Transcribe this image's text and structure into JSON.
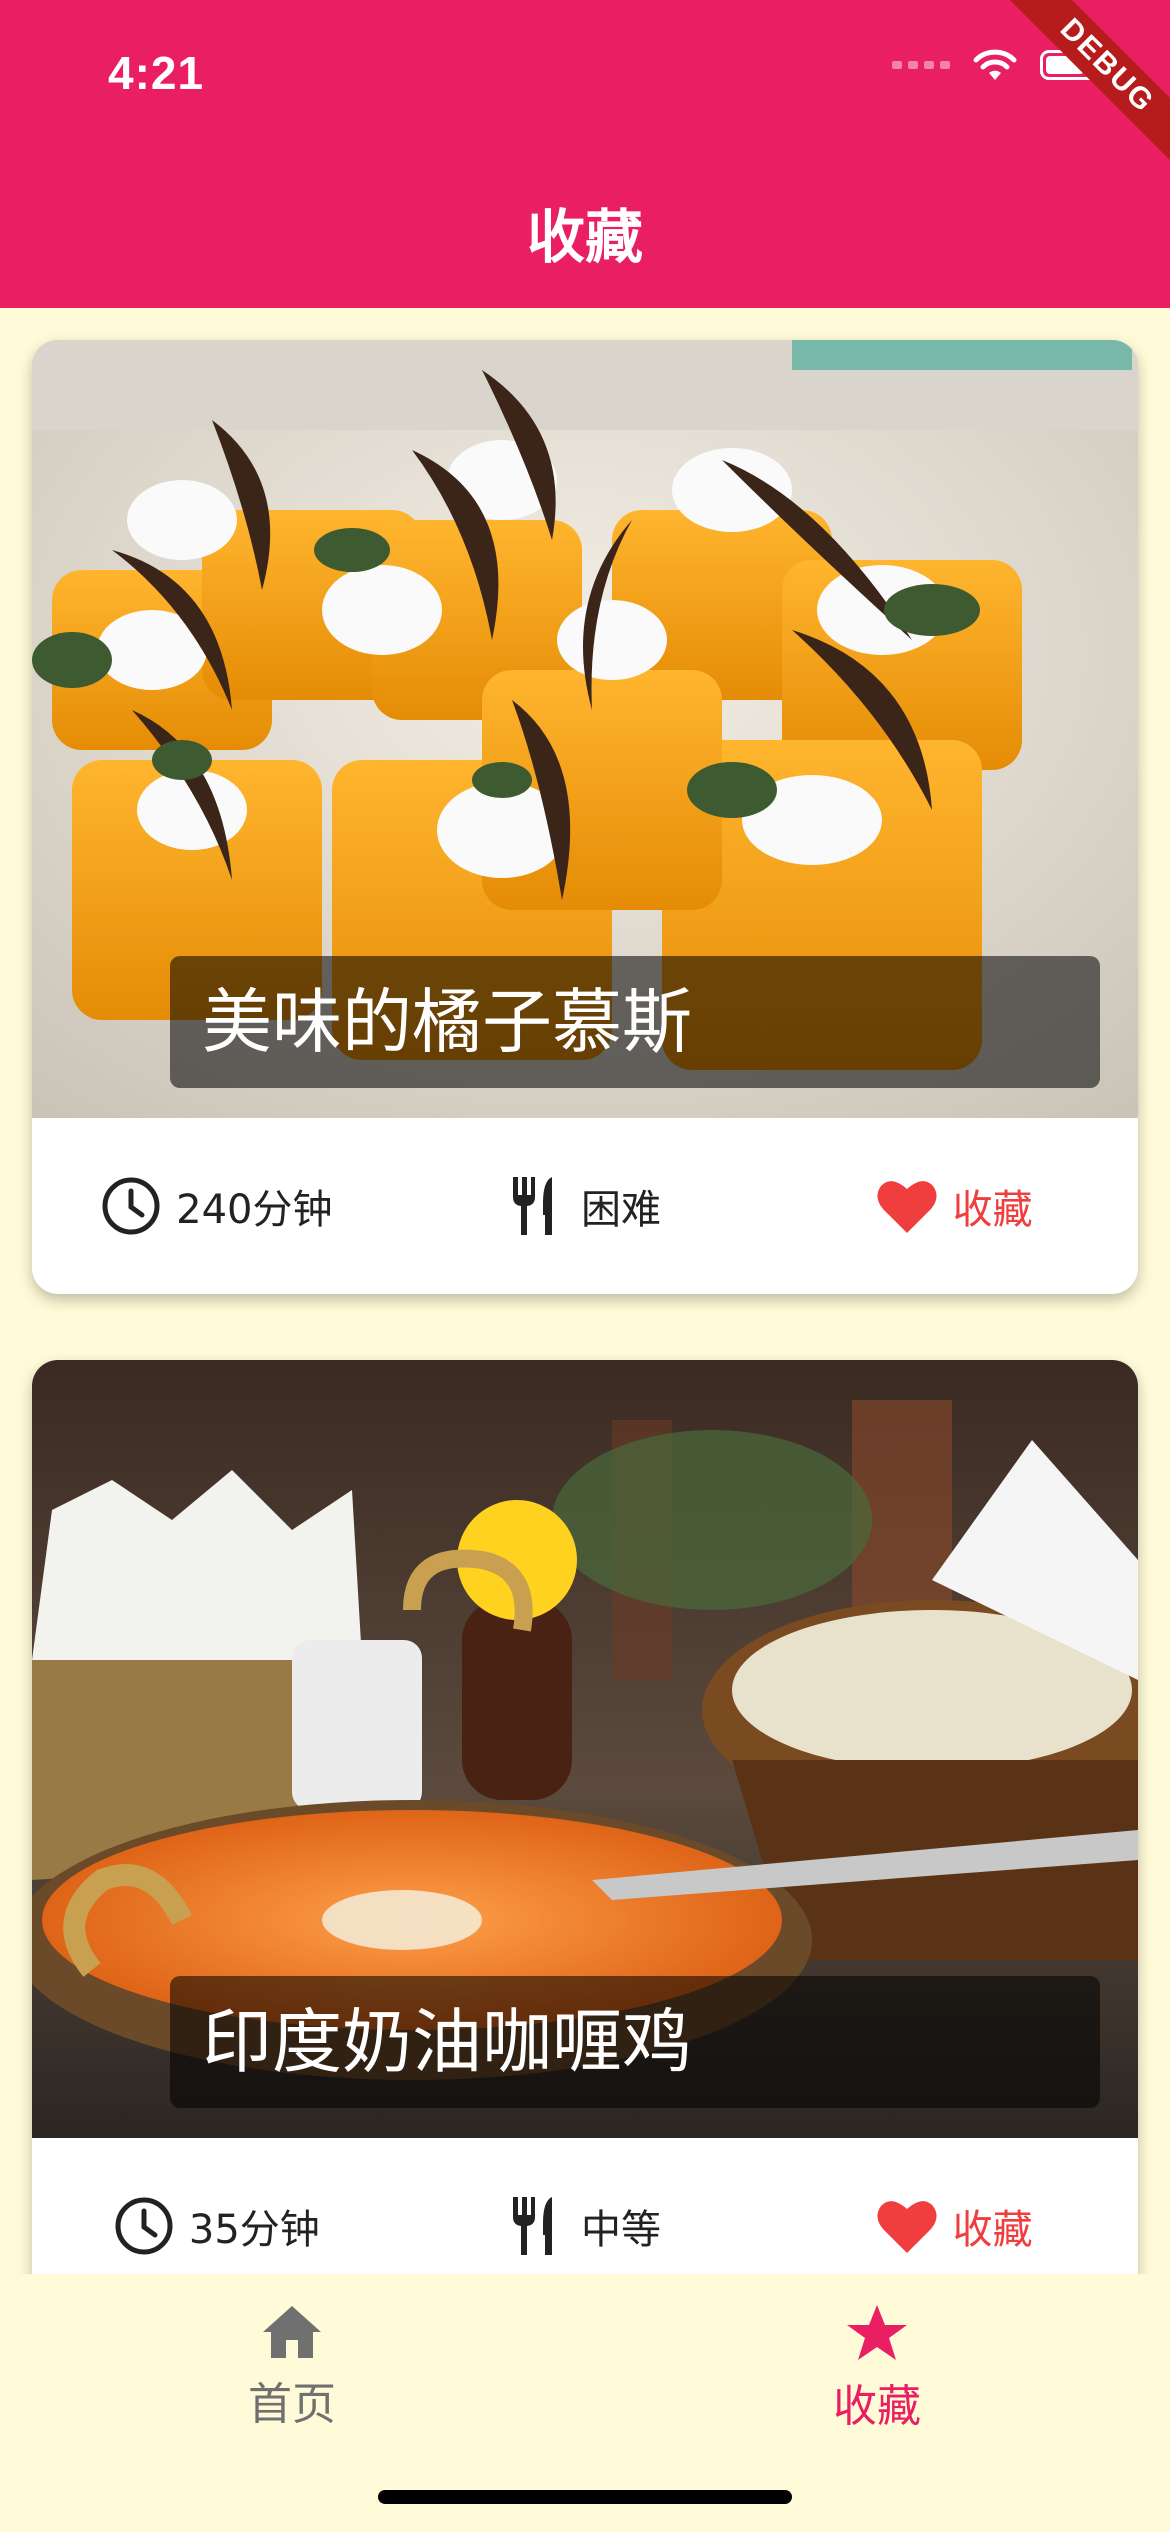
{
  "status_bar": {
    "time": "4:21"
  },
  "debug_banner": "DEBUG",
  "app_bar": {
    "title": "收藏"
  },
  "recipes": [
    {
      "title": "美味的橘子慕斯",
      "duration": "240分钟",
      "difficulty": "困难",
      "favorite_label": "收藏"
    },
    {
      "title": "印度奶油咖喱鸡",
      "duration": "35分钟",
      "difficulty": "中等",
      "favorite_label": "收藏"
    }
  ],
  "bottom_nav": {
    "items": [
      {
        "label": "首页",
        "icon": "home-icon"
      },
      {
        "label": "收藏",
        "icon": "star-icon",
        "active": true
      }
    ]
  },
  "colors": {
    "primary": "#e91e63",
    "background": "#fffbd8",
    "favorite": "#f03e3e",
    "inactive": "#707070"
  }
}
